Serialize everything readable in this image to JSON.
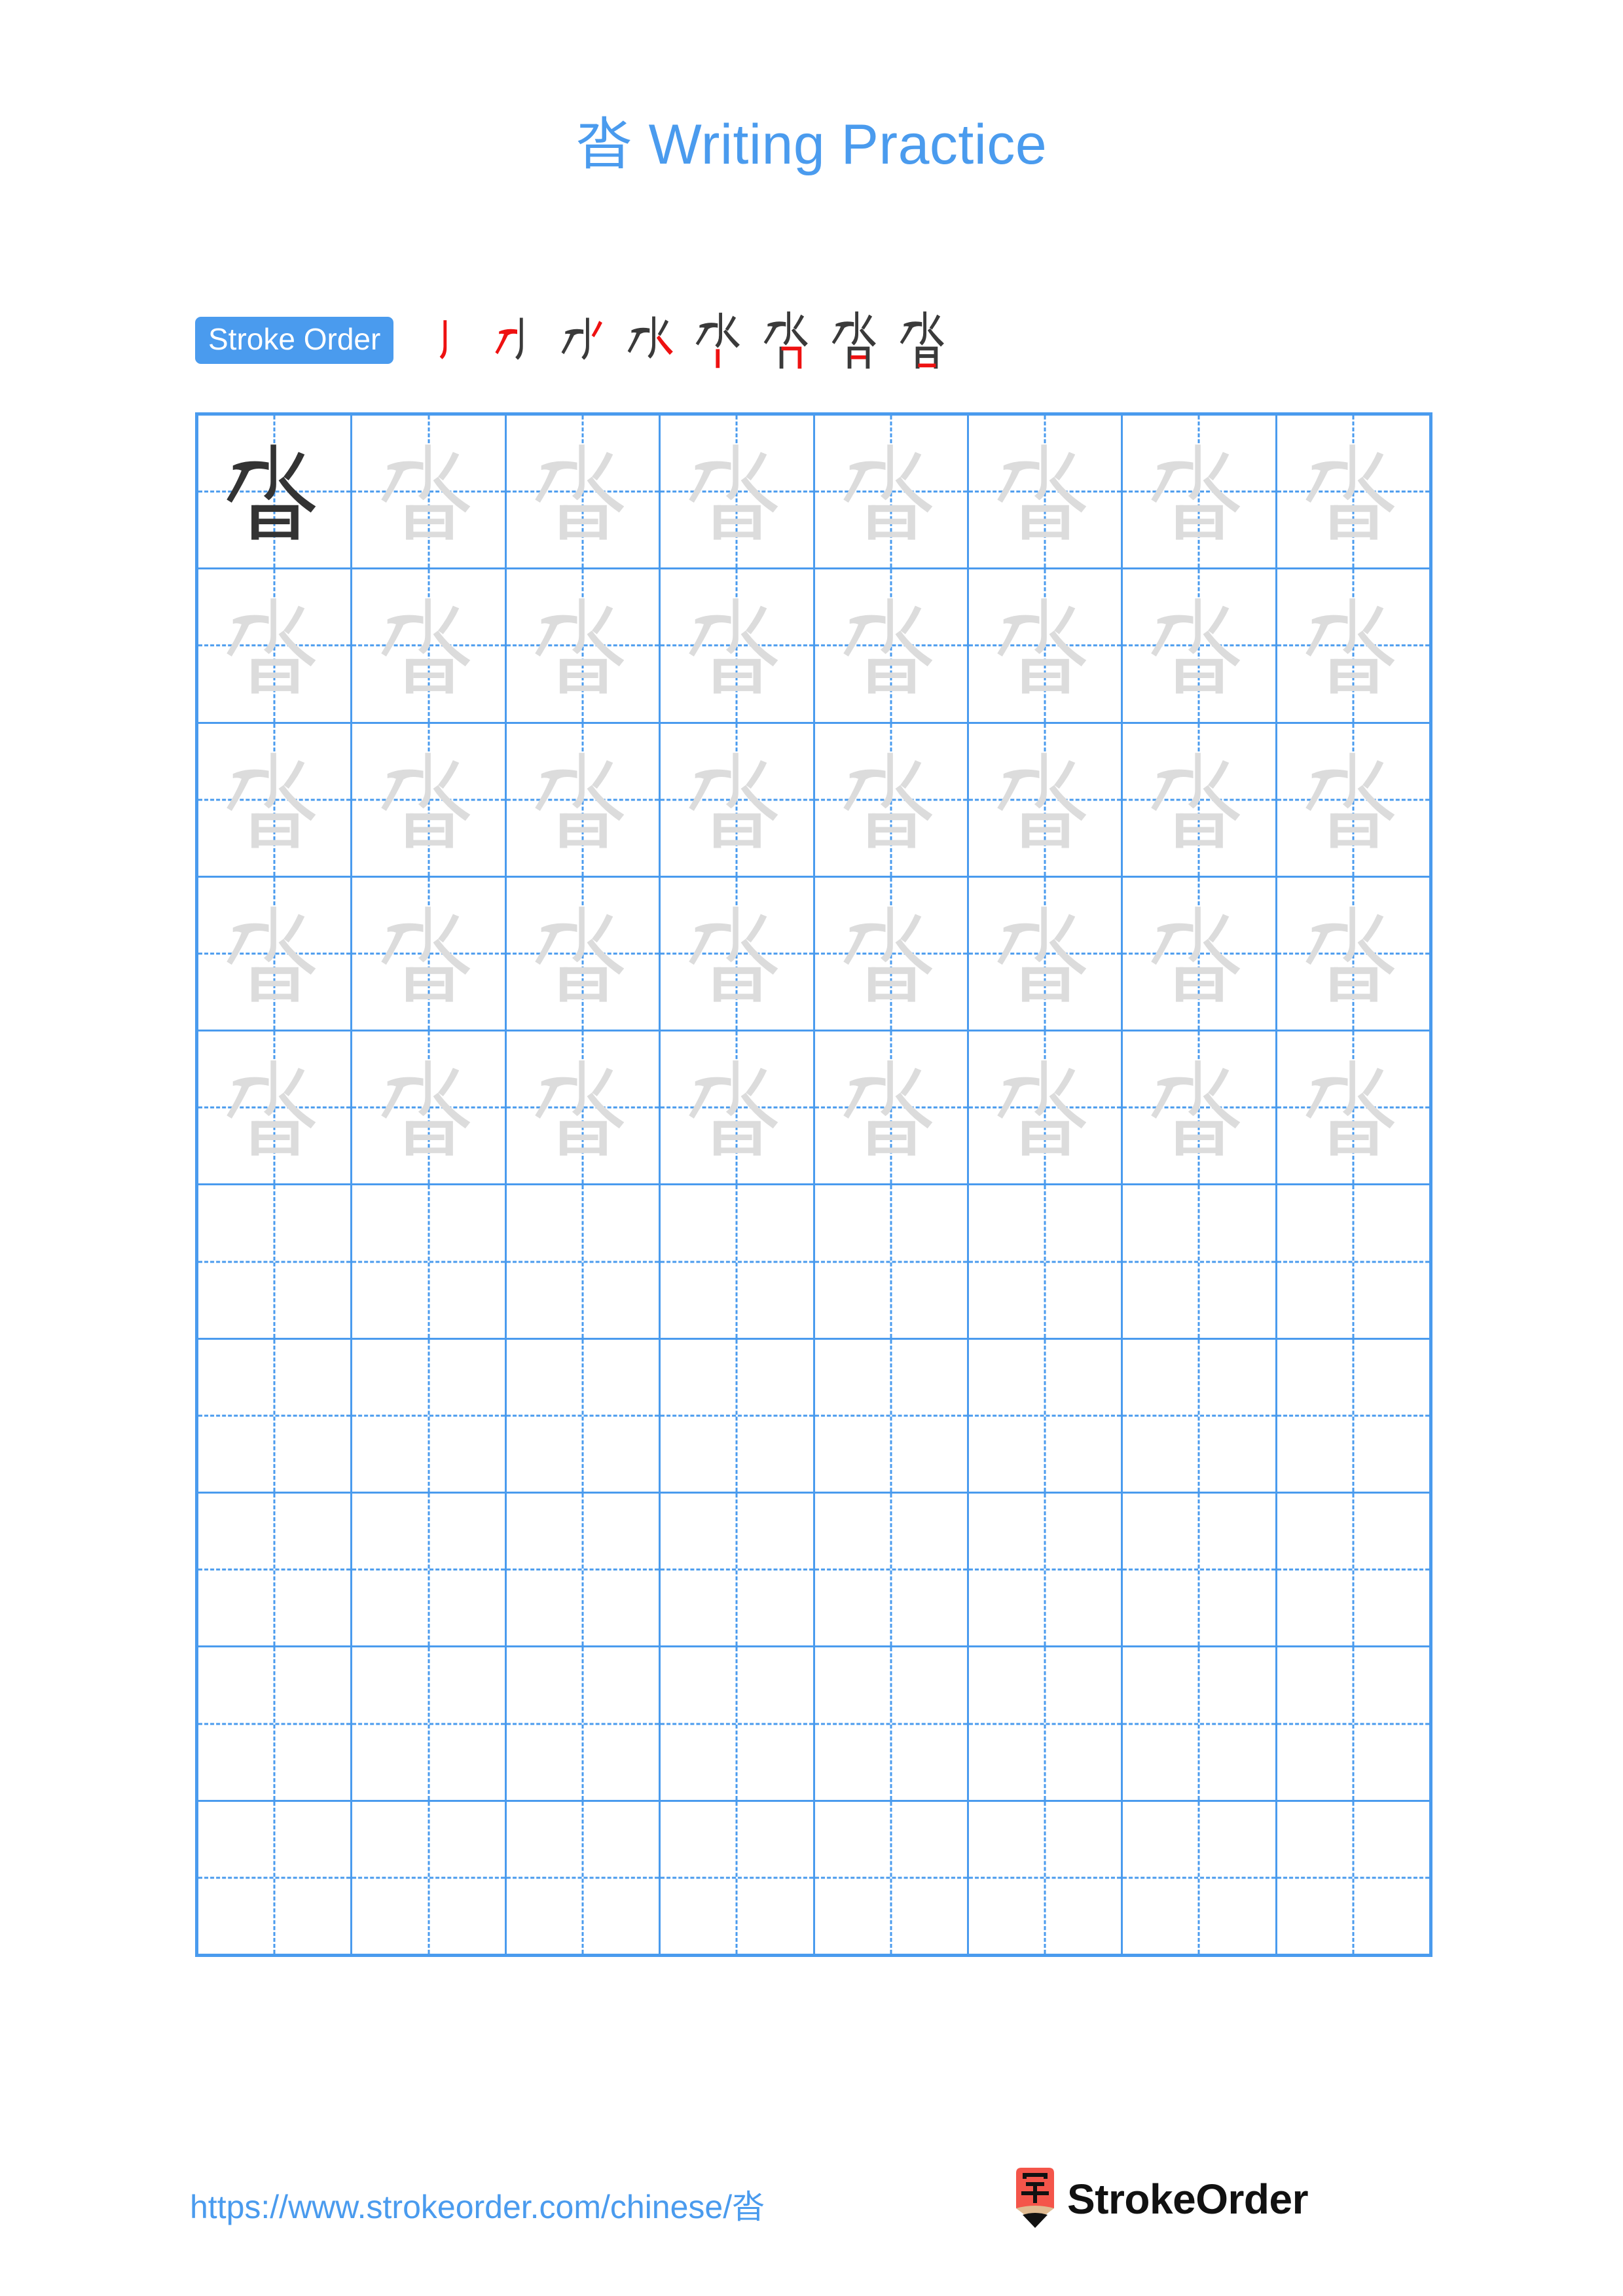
{
  "page": {
    "character": "沓",
    "background_color": "#ffffff",
    "accent_color": "#4a9bee"
  },
  "header": {
    "title": "沓 Writing Practice"
  },
  "stroke_order": {
    "badge_label": "Stroke Order",
    "badge_bg": "#4a9bee",
    "badge_text_color": "#ffffff",
    "new_stroke_color": "#ee1111",
    "prior_stroke_color": "#3a3a3a",
    "stroke_count": 8,
    "steps": [
      {
        "index": 1,
        "label": "丿"
      },
      {
        "index": 2,
        "label": "刁"
      },
      {
        "index": 3,
        "label": "水"
      },
      {
        "index": 4,
        "label": "水"
      },
      {
        "index": 5,
        "label": "水"
      },
      {
        "index": 6,
        "label": "沓"
      },
      {
        "index": 7,
        "label": "沓"
      },
      {
        "index": 8,
        "label": "沓"
      }
    ]
  },
  "grid": {
    "columns": 8,
    "rows": 10,
    "filled_rows": 5,
    "empty_rows": 5,
    "border_color": "#4a9bee",
    "guide_color": "#4a9bee",
    "dark_glyph_color": "#333333",
    "light_glyph_color": "#dcdcdc",
    "first_cell_is_dark": true,
    "cells_character": "沓"
  },
  "footer": {
    "url": "https://www.strokeorder.com/chinese/沓",
    "url_color": "#4a9bee",
    "brand_name": "StrokeOrder",
    "brand_glyph": "字",
    "pencil_body_color": "#f4554a",
    "pencil_wood_color": "#e0bb91",
    "pencil_tip_color": "#111111"
  }
}
